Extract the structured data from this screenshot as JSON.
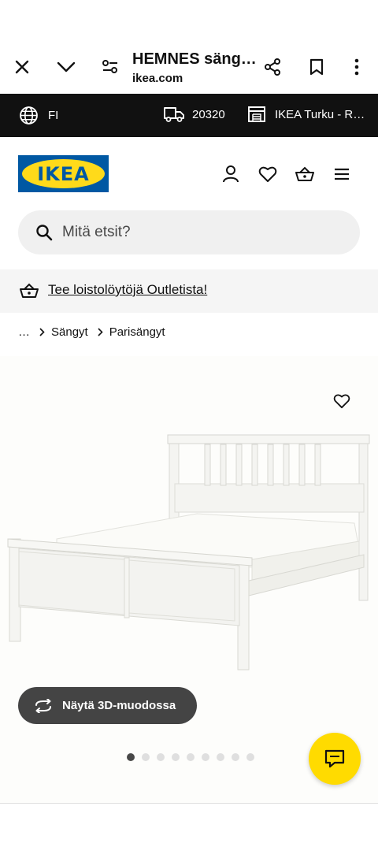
{
  "browser": {
    "title": "HEMNES säng…",
    "url": "ikea.com"
  },
  "top_strip": {
    "language": "FI",
    "postal_code": "20320",
    "store": "IKEA Turku - R…"
  },
  "header": {
    "logo_text": "IKEA"
  },
  "search": {
    "placeholder": "Mitä etsit?"
  },
  "banner": {
    "text": "Tee loistolöytöjä Outletista!"
  },
  "breadcrumb": {
    "ellipsis": "…",
    "items": [
      "Sängyt",
      "Parisängyt"
    ]
  },
  "gallery": {
    "view_3d_label": "Näytä 3D-muodossa",
    "image_count": 9,
    "active_index": 0
  },
  "colors": {
    "ikea_blue": "#0058a3",
    "ikea_yellow": "#ffda1a",
    "strip_bg": "#111111"
  }
}
